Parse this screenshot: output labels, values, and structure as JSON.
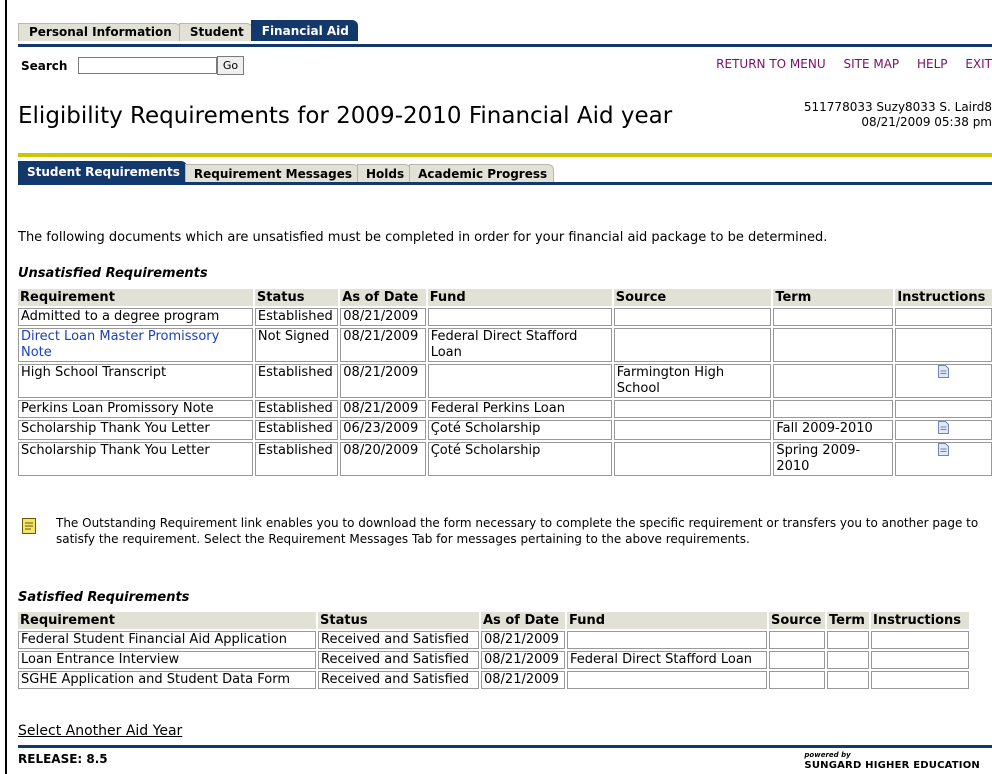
{
  "top_tabs": [
    {
      "label": "Personal Information",
      "active": false
    },
    {
      "label": "Student",
      "active": false
    },
    {
      "label": "Financial Aid",
      "active": true
    }
  ],
  "search": {
    "label": "Search",
    "value": "",
    "button": "Go"
  },
  "nav_links": [
    "RETURN TO MENU",
    "SITE MAP",
    "HELP",
    "EXIT"
  ],
  "page_title": "Eligibility Requirements for 2009-2010 Financial Aid year",
  "user": {
    "id_name": "511778033 Suzy8033 S. Laird8",
    "datetime": "08/21/2009 05:38 pm"
  },
  "sub_tabs": [
    {
      "label": "Student Requirements",
      "active": true
    },
    {
      "label": "Requirement Messages",
      "active": false
    },
    {
      "label": "Holds",
      "active": false
    },
    {
      "label": "Academic Progress",
      "active": false
    }
  ],
  "intro_text": "The following documents which are unsatisfied must be completed in order for your financial aid package to be determined.",
  "unsatisfied": {
    "heading": "Unsatisfied Requirements",
    "columns": [
      "Requirement",
      "Status",
      "As of Date",
      "Fund",
      "Source",
      "Term",
      "Instructions"
    ],
    "rows": [
      {
        "requirement": "Admitted to a degree program",
        "status": "Established",
        "date": "08/21/2009",
        "fund": "",
        "source": "",
        "term": "",
        "instructions": false,
        "link": false
      },
      {
        "requirement": "Direct Loan Master Promissory Note",
        "status": "Not Signed",
        "date": "08/21/2009",
        "fund": "Federal Direct Stafford Loan",
        "source": "",
        "term": "",
        "instructions": false,
        "link": true
      },
      {
        "requirement": "High School Transcript",
        "status": "Established",
        "date": "08/21/2009",
        "fund": "",
        "source": "Farmington High School",
        "term": "",
        "instructions": true,
        "link": false
      },
      {
        "requirement": "Perkins Loan Promissory Note",
        "status": "Established",
        "date": "08/21/2009",
        "fund": "Federal Perkins Loan",
        "source": "",
        "term": "",
        "instructions": false,
        "link": false
      },
      {
        "requirement": "Scholarship Thank You Letter",
        "status": "Established",
        "date": "06/23/2009",
        "fund": "Çoté Scholarship",
        "source": "",
        "term": "Fall 2009-2010",
        "instructions": true,
        "link": false
      },
      {
        "requirement": "Scholarship Thank You Letter",
        "status": "Established",
        "date": "08/20/2009",
        "fund": "Çoté Scholarship",
        "source": "",
        "term": "Spring 2009-2010",
        "instructions": true,
        "link": false
      }
    ]
  },
  "info_note": "The Outstanding Requirement link enables you to download the form necessary to complete the specific requirement or transfers you to another page to satisfy the requirement. Select the Requirement Messages Tab for messages pertaining to the above requirements.",
  "satisfied": {
    "heading": "Satisfied Requirements",
    "columns": [
      "Requirement",
      "Status",
      "As of Date",
      "Fund",
      "Source",
      "Term",
      "Instructions"
    ],
    "rows": [
      {
        "requirement": "Federal Student Financial Aid Application",
        "status": "Received and Satisfied",
        "date": "08/21/2009",
        "fund": "",
        "source": "",
        "term": "",
        "instructions": ""
      },
      {
        "requirement": "Loan Entrance Interview",
        "status": "Received and Satisfied",
        "date": "08/21/2009",
        "fund": "Federal Direct Stafford Loan",
        "source": "",
        "term": "",
        "instructions": ""
      },
      {
        "requirement": "SGHE Application and Student Data Form",
        "status": "Received and Satisfied",
        "date": "08/21/2009",
        "fund": "",
        "source": "",
        "term": "",
        "instructions": ""
      }
    ]
  },
  "select_link": "Select Another Aid Year",
  "release": "RELEASE: 8.5",
  "powered_by": {
    "small": "powered by",
    "brand": "SUNGARD",
    "suffix": " HIGHER EDUCATION"
  },
  "colors": {
    "navy": "#13386b",
    "tab_bg": "#e1e1d6",
    "yellow_rule": "#c8c800",
    "nav_link": "#7a0f6b",
    "link": "#1a3fbf"
  }
}
